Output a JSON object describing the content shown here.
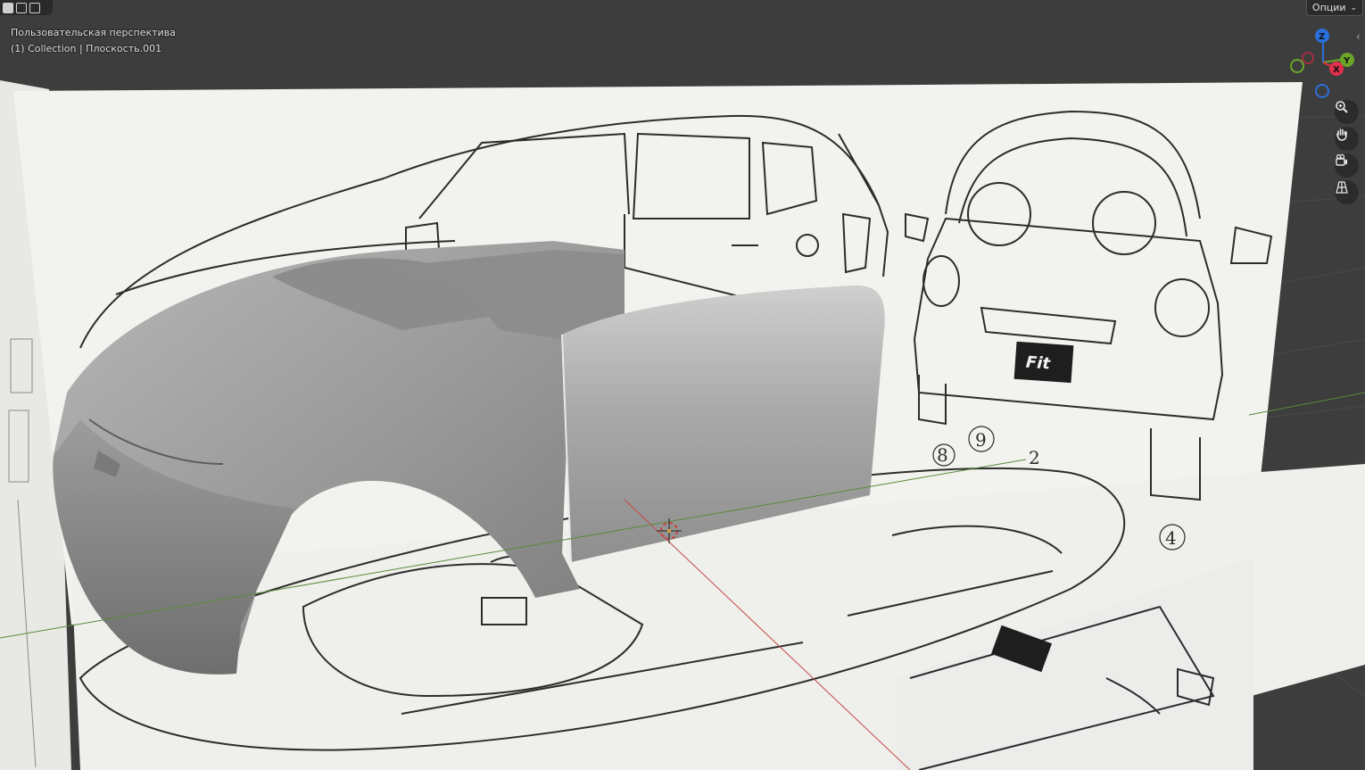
{
  "viewport": {
    "view_name": "Пользовательская перспектива",
    "collection_info": "(1) Collection | Плоскость.001",
    "options_label": "Опции",
    "options_chevron": "chevron-down-icon",
    "background_color": "#3d3d3d",
    "grid_color": "#4a4a4a",
    "paper_color": "#f2f2ee"
  },
  "gizmo": {
    "axes": [
      {
        "label": "Z",
        "color": "#2a6fdb"
      },
      {
        "label": "Y",
        "color": "#6ba52a"
      },
      {
        "label": "X",
        "color": "#e0304a"
      }
    ]
  },
  "nav_tools": [
    {
      "icon": "zoom-icon"
    },
    {
      "icon": "hand-pan-icon"
    },
    {
      "icon": "camera-icon"
    },
    {
      "icon": "perspective-grid-icon"
    }
  ],
  "blueprint": {
    "callouts": [
      "9",
      "2",
      "8",
      "4"
    ],
    "badge_text": "Fit"
  }
}
